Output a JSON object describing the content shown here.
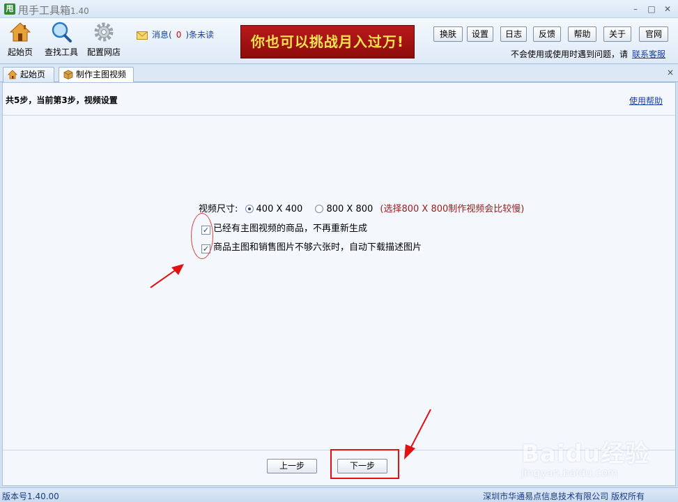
{
  "app": {
    "icon_char": "甩",
    "title": "甩手工具箱",
    "version": "1.40",
    "window_controls": [
      "–",
      "□",
      "✕"
    ]
  },
  "toolbar": {
    "tools": [
      {
        "label": "起始页",
        "icon": "home-icon"
      },
      {
        "label": "查找工具",
        "icon": "search-icon"
      },
      {
        "label": "配置网店",
        "icon": "gear-icon"
      }
    ],
    "message": {
      "prefix": "消息(",
      "count": "0",
      "suffix": ")条未读"
    },
    "banner": "你也可以挑战月入过万!",
    "buttons": [
      "换肤",
      "设置",
      "日志",
      "反馈",
      "帮助",
      "关于",
      "官网"
    ],
    "help_hint": "不会使用或使用时遇到问题，请",
    "contact_link": "联系客服"
  },
  "tabs": [
    {
      "label": "起始页",
      "icon": "home-icon",
      "active": false
    },
    {
      "label": "制作主图视频",
      "icon": "box-icon",
      "active": true
    }
  ],
  "tab_close": "×",
  "content": {
    "step_header": "共5步，当前第3步，视频设置",
    "help_link": "使用帮助",
    "size_label": "视频尺寸:",
    "size_options": [
      {
        "label": "400 X 400",
        "checked": true
      },
      {
        "label": "800 X 800",
        "checked": false
      }
    ],
    "size_note": "(选择800 X 800制作视频会比较慢)",
    "checkboxes": [
      {
        "label": "已经有主图视频的商品，不再重新生成",
        "checked": true
      },
      {
        "label": "商品主图和销售图片不够六张时，自动下载描述图片",
        "checked": true
      }
    ],
    "check_mark": "✓",
    "prev_button": "上一步",
    "next_button": "下一步"
  },
  "status": {
    "version": "版本号1.40.00",
    "copyright": "深圳市华通易点信息技术有限公司 版权所有"
  },
  "watermark": {
    "logo": "Baidu经验",
    "url": "jingyan.baidu.com"
  },
  "colors": {
    "annotation": "#e41010",
    "banner_bg": "#a41313",
    "banner_text": "#ffe34d",
    "link": "#1c3ea8"
  }
}
